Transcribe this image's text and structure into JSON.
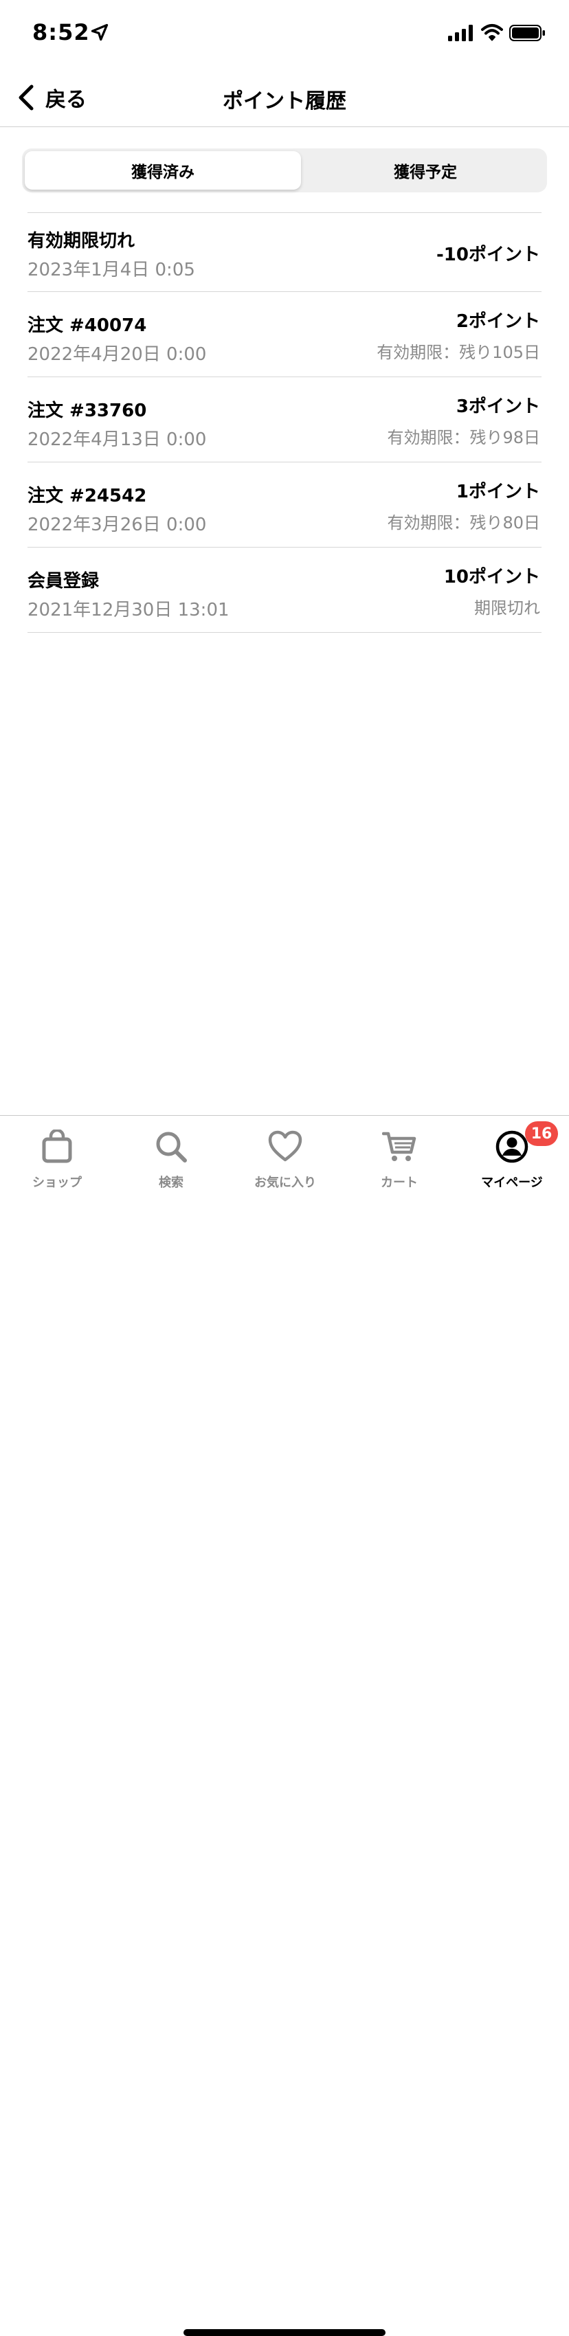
{
  "status_bar": {
    "time": "8:52"
  },
  "nav": {
    "back_label": "戻る",
    "title": "ポイント履歴"
  },
  "segmented": {
    "tabs": [
      {
        "label": "獲得済み",
        "selected": true
      },
      {
        "label": "獲得予定",
        "selected": false
      }
    ]
  },
  "history": [
    {
      "title": "有効期限切れ",
      "date": "2023年1月4日 0:05",
      "points": "-10ポイント",
      "sub": ""
    },
    {
      "title": "注文 #40074",
      "date": "2022年4月20日 0:00",
      "points": "2ポイント",
      "sub": "有効期限：残り105日"
    },
    {
      "title": "注文 #33760",
      "date": "2022年4月13日 0:00",
      "points": "3ポイント",
      "sub": "有効期限：残り98日"
    },
    {
      "title": "注文 #24542",
      "date": "2022年3月26日 0:00",
      "points": "1ポイント",
      "sub": "有効期限：残り80日"
    },
    {
      "title": "会員登録",
      "date": "2021年12月30日 13:01",
      "points": "10ポイント",
      "sub": "期限切れ"
    }
  ],
  "tab_bar": {
    "items": [
      {
        "label": "ショップ",
        "icon": "shopping-bag-icon"
      },
      {
        "label": "検索",
        "icon": "search-icon"
      },
      {
        "label": "お気に入り",
        "icon": "heart-icon"
      },
      {
        "label": "カート",
        "icon": "cart-icon"
      },
      {
        "label": "マイページ",
        "icon": "user-circle-icon",
        "active": true,
        "badge": "16"
      }
    ]
  },
  "colors": {
    "badge": "#f04a44",
    "inactive_tab": "#8a8a8a",
    "secondary_text": "#8a8a8a",
    "segment_bg": "#efefef"
  }
}
